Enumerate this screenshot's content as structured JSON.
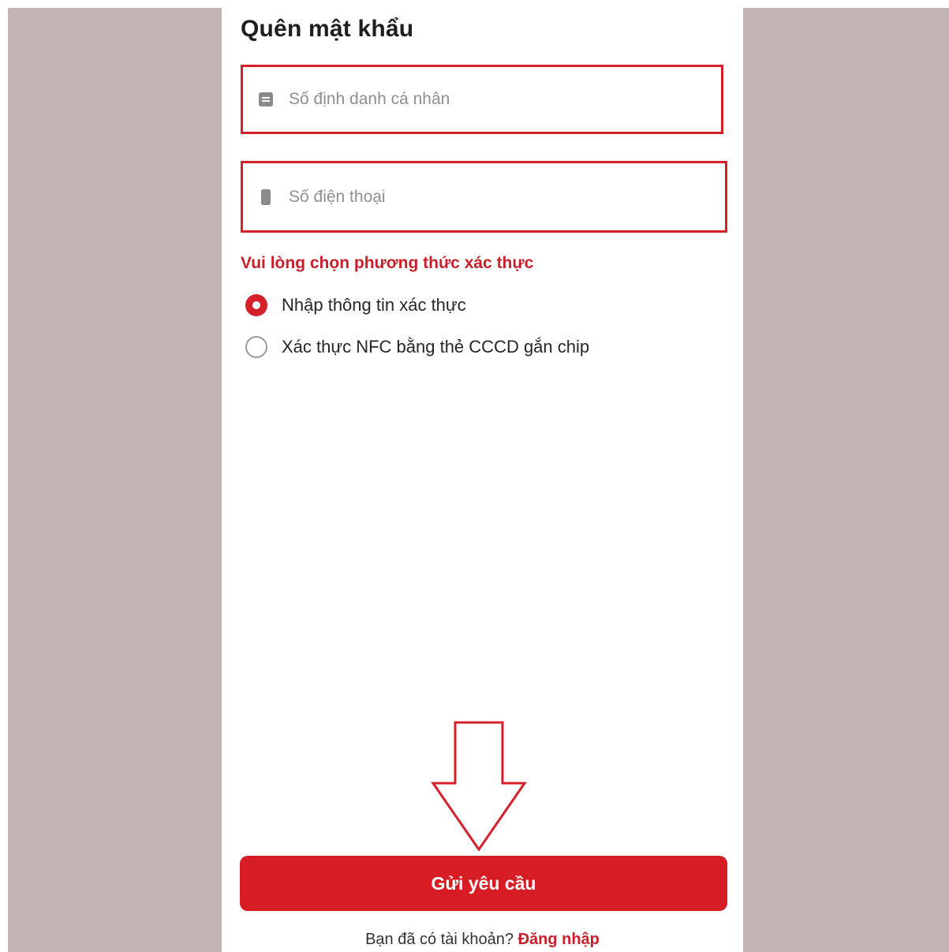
{
  "page": {
    "title": "Quên mật khẩu"
  },
  "form": {
    "id_field": {
      "placeholder": "Số định danh cá nhân",
      "value": "",
      "icon": "id-card-icon"
    },
    "phone_field": {
      "placeholder": "Số điện thoại",
      "value": "",
      "icon": "phone-icon"
    }
  },
  "verification": {
    "label": "Vui lòng chọn phương thức xác thực",
    "options": [
      {
        "label": "Nhập thông tin xác thực",
        "selected": true
      },
      {
        "label": "Xác thực NFC bằng thẻ CCCD gắn chip",
        "selected": false
      }
    ]
  },
  "annotation": {
    "icon": "down-arrow-icon"
  },
  "actions": {
    "submit_label": "Gửi yêu cầu"
  },
  "footer": {
    "prompt": "Bạn đã có tài khoản?",
    "login_label": "Đăng nhập"
  },
  "colors": {
    "accent": "#d71d24",
    "backdrop": "#c4b5b5"
  }
}
